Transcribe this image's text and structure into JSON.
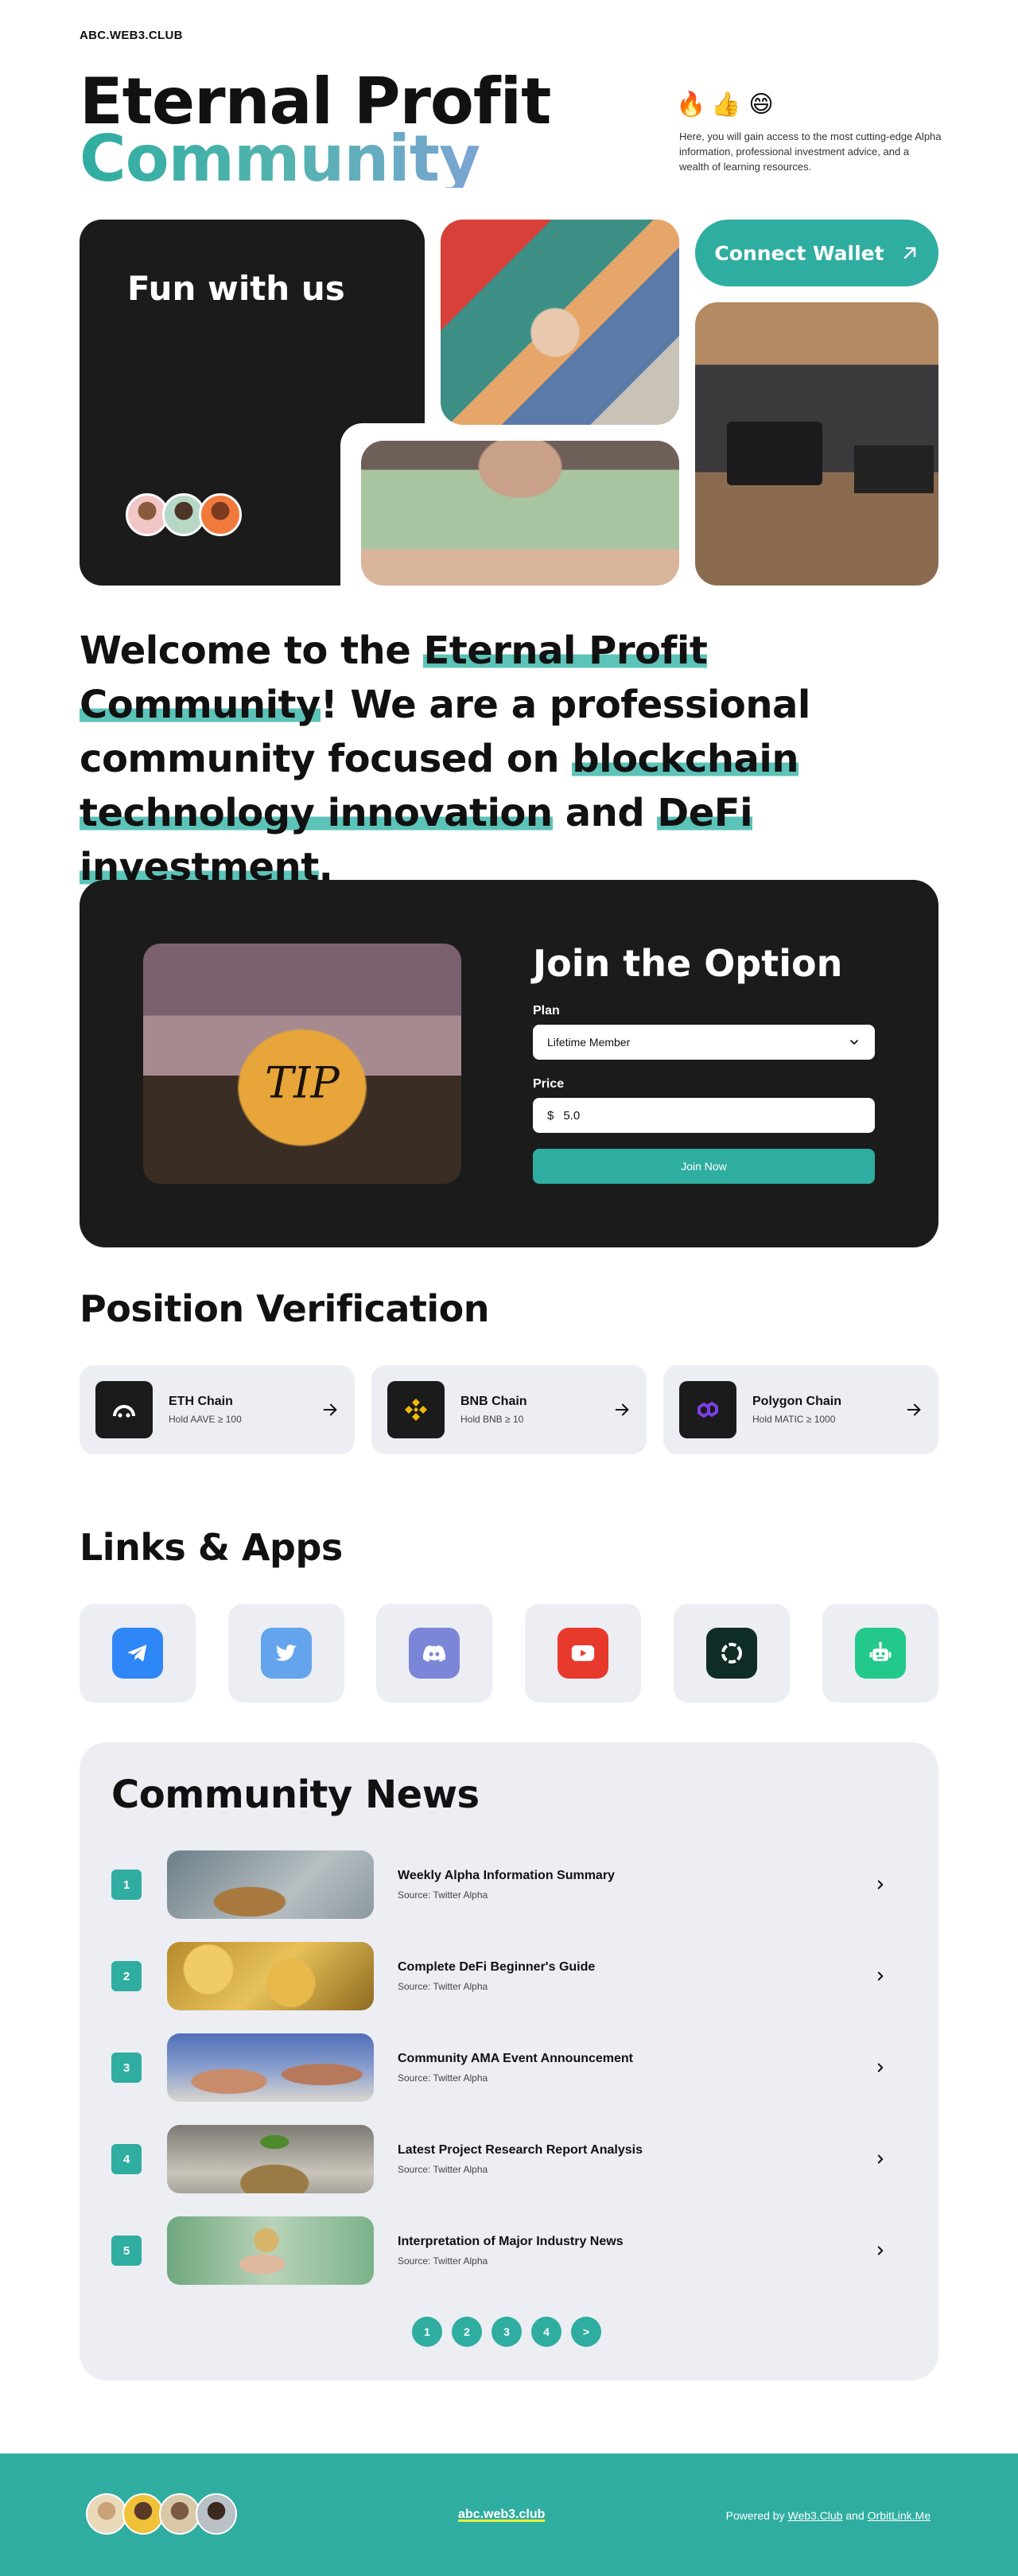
{
  "header": {
    "site_name": "ABC.WEB3.CLUB",
    "title_line1": "Eternal Profit",
    "title_line2": "Community",
    "emojis": [
      "🔥",
      "👍",
      "😄"
    ],
    "description": "Here, you will gain access to the most cutting-edge Alpha information, professional investment advice, and a wealth of learning resources."
  },
  "hero": {
    "fun_label": "Fun with us",
    "connect_label": "Connect Wallet"
  },
  "welcome": {
    "p1": "Welcome to the ",
    "h1": "Eternal Profit Community",
    "p2": "! We are a professional community focused on ",
    "h2": "blockchain technology innovation",
    "p3": " and ",
    "h3": "DeFi investment",
    "p4": "."
  },
  "join": {
    "image_text": "TIP",
    "title": "Join the Option",
    "plan_label": "Plan",
    "plan_value": "Lifetime Member",
    "price_label": "Price",
    "currency": "$",
    "price_value": "5.0",
    "button": "Join Now"
  },
  "verification": {
    "heading": "Position Verification",
    "chains": [
      {
        "name": "ETH Chain",
        "requirement": "Hold AAVE ≥ 100",
        "icon": "aave-icon"
      },
      {
        "name": "BNB Chain",
        "requirement": "Hold BNB ≥ 10",
        "icon": "bnb-icon"
      },
      {
        "name": "Polygon Chain",
        "requirement": "Hold MATIC ≥ 1000",
        "icon": "polygon-icon"
      }
    ]
  },
  "links": {
    "heading": "Links & Apps",
    "apps": [
      {
        "icon": "telegram-icon",
        "color": "#2f86f6"
      },
      {
        "icon": "twitter-icon",
        "color": "#63a4ec"
      },
      {
        "icon": "discord-icon",
        "color": "#7b86d8"
      },
      {
        "icon": "youtube-icon",
        "color": "#e8392d"
      },
      {
        "icon": "app-ring-icon",
        "color": "#0f2d27"
      },
      {
        "icon": "robot-icon",
        "color": "#22c98a"
      }
    ]
  },
  "news": {
    "heading": "Community News",
    "items": [
      {
        "num": "1",
        "title": "Weekly Alpha Information Summary",
        "source": "Source: Twitter Alpha"
      },
      {
        "num": "2",
        "title": "Complete DeFi Beginner's Guide",
        "source": "Source: Twitter Alpha"
      },
      {
        "num": "3",
        "title": "Community AMA Event Announcement",
        "source": "Source: Twitter Alpha"
      },
      {
        "num": "4",
        "title": "Latest Project Research Report Analysis",
        "source": "Source: Twitter Alpha"
      },
      {
        "num": "5",
        "title": "Interpretation of Major Industry News",
        "source": "Source: Twitter Alpha"
      }
    ],
    "pages": [
      "1",
      "2",
      "3",
      "4",
      ">"
    ]
  },
  "footer": {
    "domain": "abc.web3.club",
    "powered_prefix": "Powered by ",
    "link1": "Web3.Club",
    "and": " and ",
    "link2": "OrbitLink.Me"
  },
  "colors": {
    "accent": "#2fada1",
    "dark": "#1b1b1b",
    "card": "#eceef3"
  }
}
